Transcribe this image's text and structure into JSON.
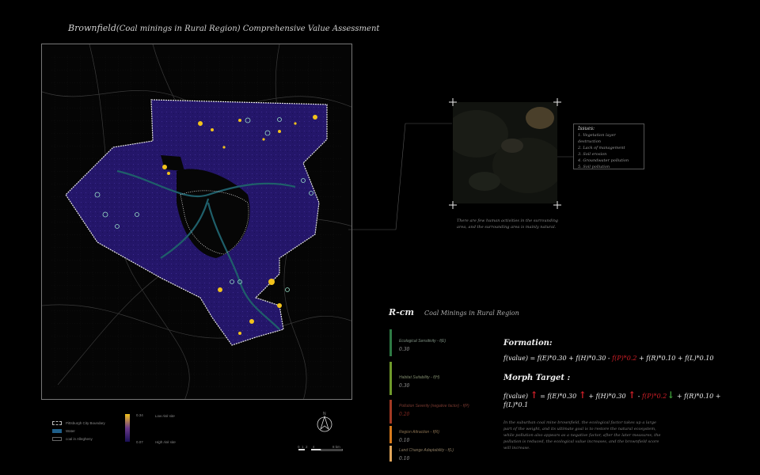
{
  "title": {
    "prefix": "Brownfield",
    "paren": "(Coal minings in Rural Region)",
    "suffix": " Comprehensive Value Assessment"
  },
  "legend": {
    "boundary": "Pittsburgh City Boundary",
    "water": "Water",
    "coal": "coal in Allegheny",
    "scale_top": "0.34",
    "scale_bottom": "0.07",
    "low_risk": "Low risk site",
    "high_risk": "High risk site",
    "north": "N",
    "scale_ticks": "0  1  2     4",
    "scale_unit": "8  km"
  },
  "issues": {
    "title": "Issues:",
    "items": [
      "1. Vegetation layer destruction",
      "2. Lack of management",
      "3. Soil erosion",
      "4. Groundwater pollution",
      "5. Soil pollution"
    ]
  },
  "caption": "There are few human activities in the surrounding area, and the surrounding area is mainly natural.",
  "rcm": {
    "code": "R-cm",
    "name": "Coal Minings in Rural Region"
  },
  "factors": [
    {
      "label": "Ecological Sensitivity - f(E)",
      "value": "0.30",
      "color": "#2e7a44"
    },
    {
      "label": "Habitat Suitability - f(H)",
      "value": "0.30",
      "color": "#6f9a2b"
    },
    {
      "label": "Pollution Severity (negative factor) - f(P)",
      "value": "0.20",
      "color": "#a33a23"
    },
    {
      "label": "Region Attraction - f(R)",
      "value": "0.10",
      "color": "#d77a1c"
    },
    {
      "label": "Land Change Adaptability - f(L)",
      "value": "0.10",
      "color": "#e0a55a"
    }
  ],
  "formation": {
    "heading": "Formation:",
    "p1": "f(value) = f(E)*0.30 + f(H)*0.30 - ",
    "p2": "f(P)*0.2",
    "p3": " + f(R)*0.10 + f(L)*0.10"
  },
  "morph": {
    "heading": "Morph Target :",
    "a": "f(value) ",
    "b": " = f(E)*0.30 ",
    "c": " + f(H)*0.30 ",
    "d": " - ",
    "e": "f(P)*0.2",
    "f": " + f(R)*0.10 +",
    "line2": "f(L)*0.1",
    "up": "↑",
    "down": "↓"
  },
  "description": "In the suburban coal mine brownfield, the ecological factor takes up a large part of the weight, and its ultimate goal is to restore the natural ecosystem, while pollution also appears as a negative factor, after the later measures, the pollution is reduced, the ecological value increases, and the brownfield score will increase.",
  "colors": {
    "red": "#d21f28",
    "green": "#3fa03a",
    "hotspot": "#f2c21b",
    "base": "#2a1b6e"
  }
}
